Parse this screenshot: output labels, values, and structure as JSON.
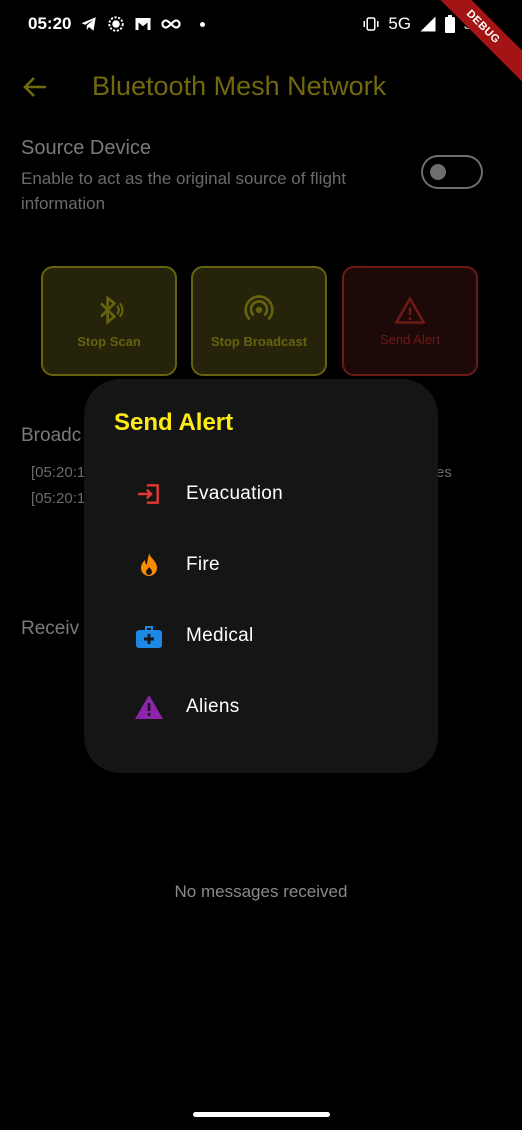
{
  "status_bar": {
    "time": "05:20",
    "network": "5G",
    "battery": "99",
    "debug_banner": "DEBUG"
  },
  "appbar": {
    "title": "Bluetooth Mesh Network"
  },
  "source_device": {
    "title": "Source Device",
    "subtitle": "Enable to act as the original source of flight information",
    "enabled": false
  },
  "actions": [
    {
      "label": "Stop Scan",
      "icon": "bluetooth-searching-icon"
    },
    {
      "label": "Stop Broadcast",
      "icon": "broadcast-icon"
    },
    {
      "label": "Send Alert",
      "icon": "warning-icon"
    }
  ],
  "broadcast_section": {
    "title_visible": "Broadc",
    "log_lines": [
      "[05:20:1",
      "[05:20:1"
    ],
    "trailing_fragment": "es"
  },
  "received_section": {
    "title_visible": "Receiv",
    "empty_message": "No messages received"
  },
  "dialog": {
    "title": "Send Alert",
    "options": [
      {
        "label": "Evacuation",
        "icon": "exit-icon",
        "color": "#e53935"
      },
      {
        "label": "Fire",
        "icon": "fire-icon",
        "color": "#fb8c00"
      },
      {
        "label": "Medical",
        "icon": "medical-kit-icon",
        "color": "#1e88e5"
      },
      {
        "label": "Aliens",
        "icon": "warning-triangle-icon",
        "color": "#8e24aa"
      }
    ]
  },
  "colors": {
    "accent_yellow": "#ffeb14",
    "background": "#000000",
    "dialog_bg": "#151515"
  }
}
